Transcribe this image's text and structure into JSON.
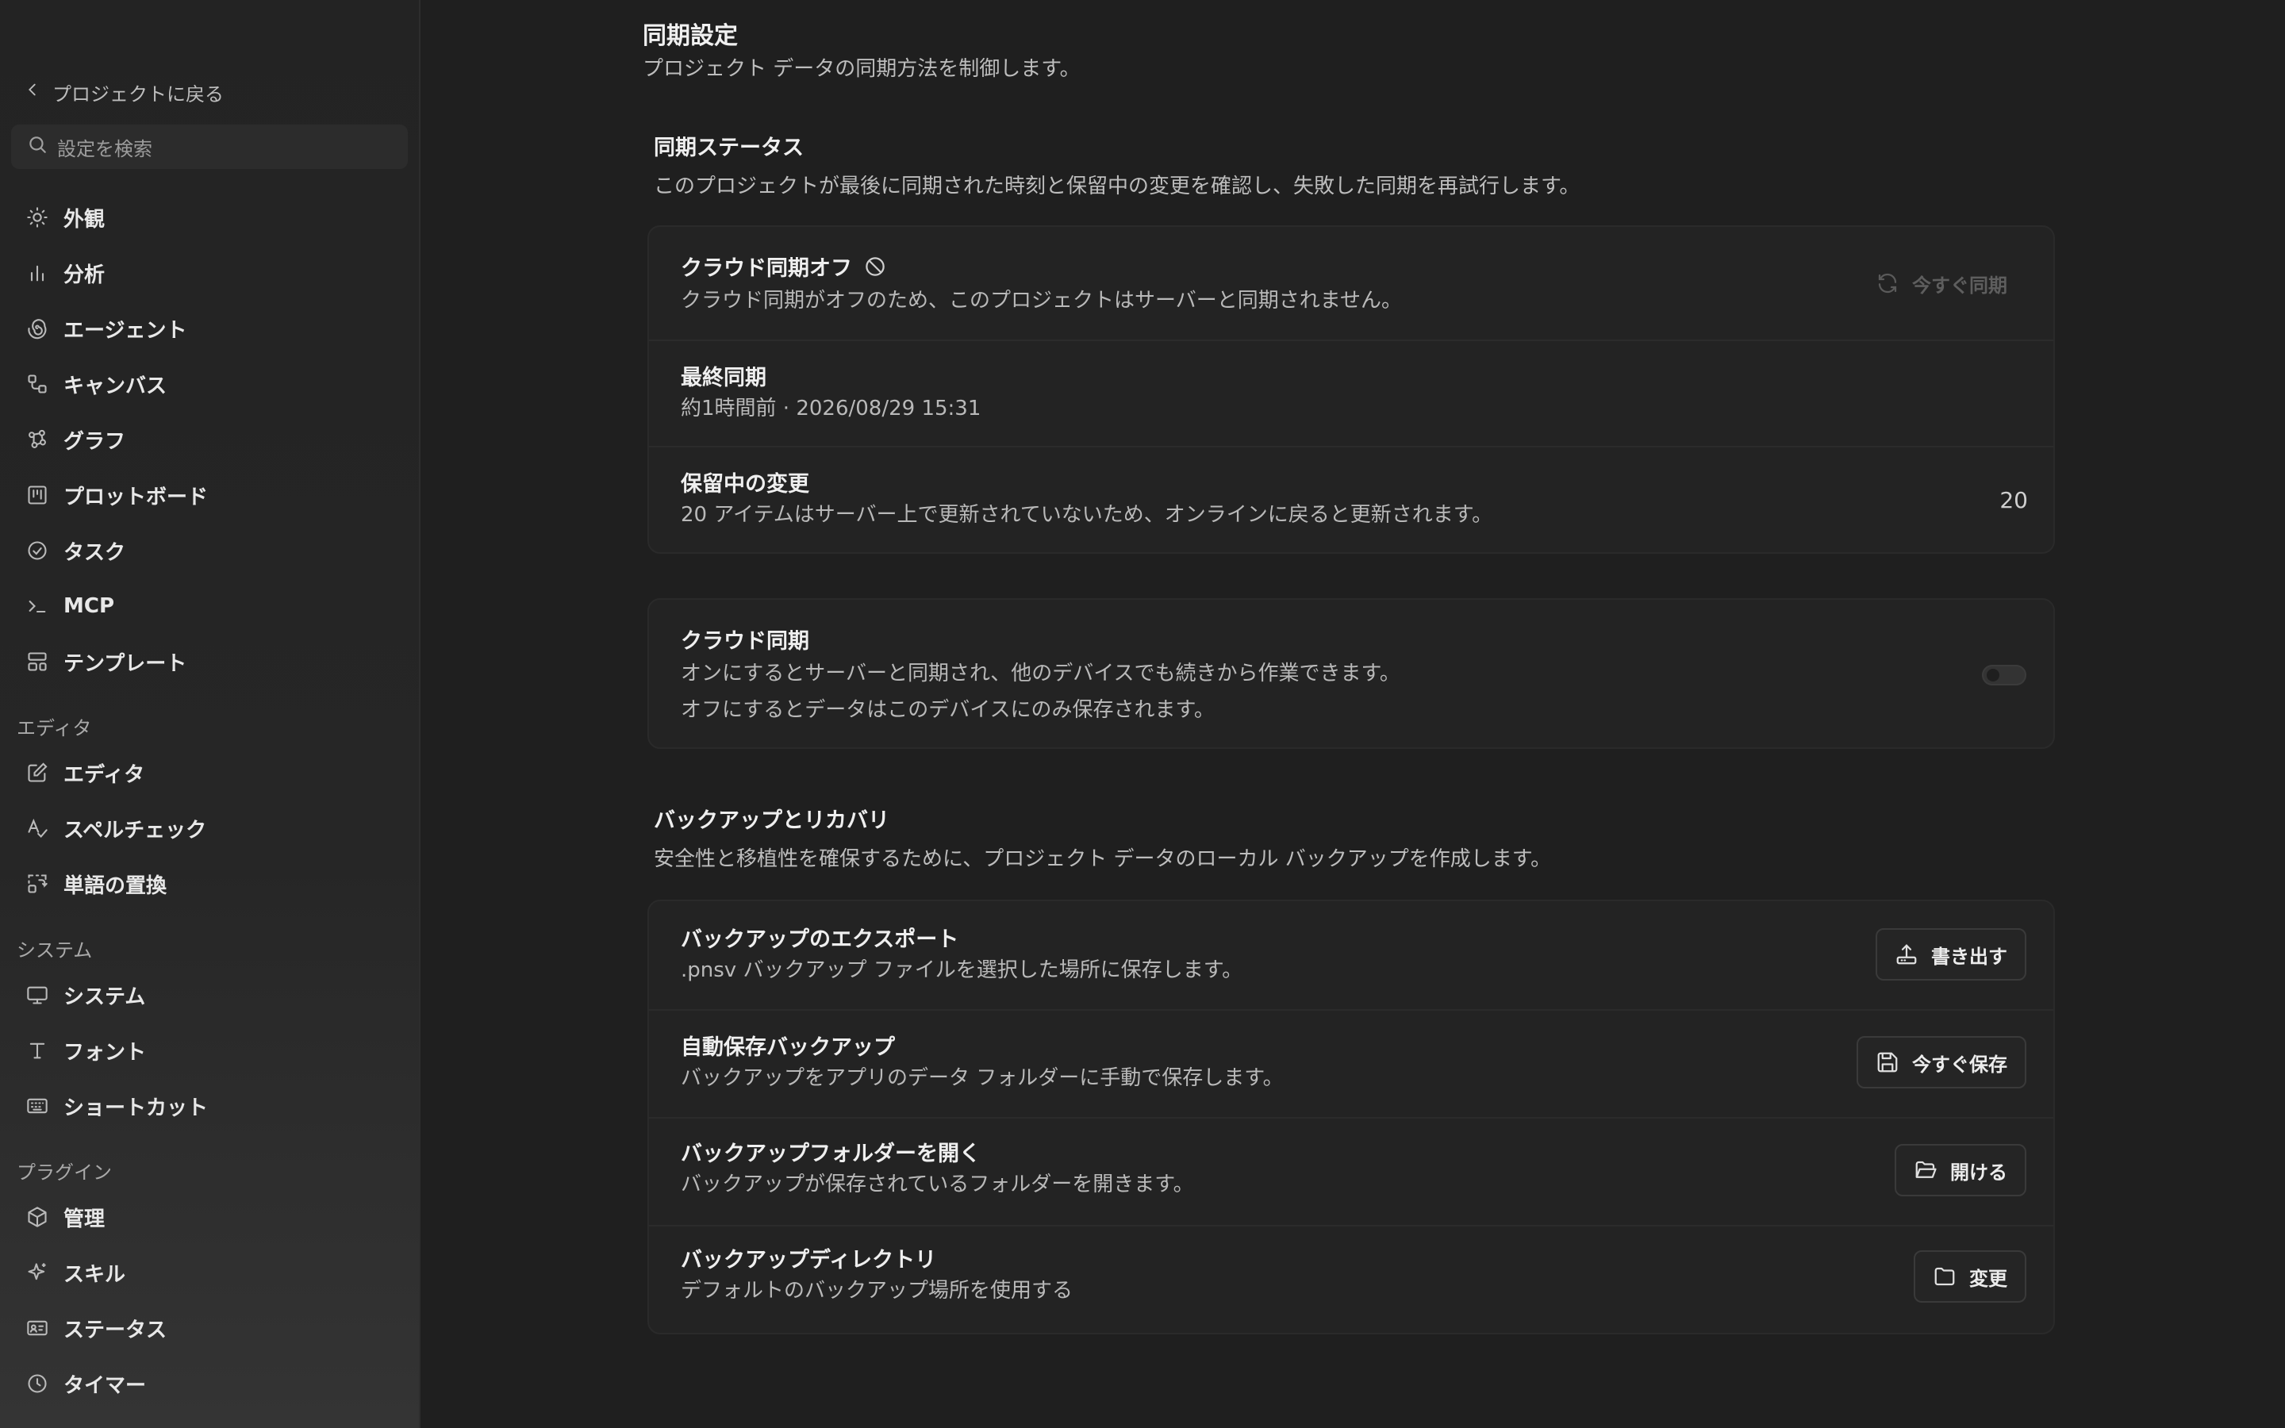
{
  "sidebar": {
    "back_label": "プロジェクトに戻る",
    "search_placeholder": "設定を検索",
    "items": [
      {
        "label": "外観",
        "icon": "sun-icon"
      },
      {
        "label": "分析",
        "icon": "bar-chart-icon"
      },
      {
        "label": "エージェント",
        "icon": "spiral-icon"
      },
      {
        "label": "キャンバス",
        "icon": "canvas-icon"
      },
      {
        "label": "グラフ",
        "icon": "graph-icon"
      },
      {
        "label": "プロットボード",
        "icon": "kanban-icon"
      },
      {
        "label": "タスク",
        "icon": "check-circle-icon"
      },
      {
        "label": "MCP",
        "icon": "terminal-icon"
      },
      {
        "label": "テンプレート",
        "icon": "template-icon"
      }
    ],
    "editor_group": "エディタ",
    "editor_items": [
      {
        "label": "エディタ",
        "icon": "edit-icon"
      },
      {
        "label": "スペルチェック",
        "icon": "spellcheck-icon"
      },
      {
        "label": "単語の置換",
        "icon": "replace-icon"
      }
    ],
    "system_group": "システム",
    "system_items": [
      {
        "label": "システム",
        "icon": "monitor-icon"
      },
      {
        "label": "フォント",
        "icon": "type-icon"
      },
      {
        "label": "ショートカット",
        "icon": "keyboard-icon"
      }
    ],
    "plugin_group": "プラグイン",
    "plugin_items": [
      {
        "label": "管理",
        "icon": "box-icon"
      },
      {
        "label": "スキル",
        "icon": "sparkle-icon"
      },
      {
        "label": "ステータス",
        "icon": "id-card-icon"
      },
      {
        "label": "タイマー",
        "icon": "clock-icon"
      }
    ]
  },
  "main": {
    "title": "同期設定",
    "subtitle": "プロジェクト データの同期方法を制御します。",
    "sync_status": {
      "title": "同期ステータス",
      "description": "このプロジェクトが最後に同期された時刻と保留中の変更を確認し、失敗した同期を再試行します。",
      "cloud_off": {
        "title": "クラウド同期オフ",
        "description": "クラウド同期がオフのため、このプロジェクトはサーバーと同期されません。",
        "button": "今すぐ同期"
      },
      "last_sync": {
        "title": "最終同期",
        "value": "約1時間前 · 2026/08/29 15:31"
      },
      "pending": {
        "title": "保留中の変更",
        "description": "20 アイテムはサーバー上で更新されていないため、オンラインに戻ると更新されます。",
        "count": "20"
      }
    },
    "cloud_sync": {
      "title": "クラウド同期",
      "line1": "オンにするとサーバーと同期され、他のデバイスでも続きから作業できます。",
      "line2": "オフにするとデータはこのデバイスにのみ保存されます。",
      "enabled": false
    },
    "backup": {
      "title": "バックアップとリカバリ",
      "description": "安全性と移植性を確保するために、プロジェクト データのローカル バックアップを作成します。",
      "export": {
        "title": "バックアップのエクスポート",
        "description": ".pnsv バックアップ ファイルを選択した場所に保存します。",
        "button": "書き出す"
      },
      "autosave": {
        "title": "自動保存バックアップ",
        "description": "バックアップをアプリのデータ フォルダーに手動で保存します。",
        "button": "今すぐ保存"
      },
      "open_folder": {
        "title": "バックアップフォルダーを開く",
        "description": "バックアップが保存されているフォルダーを開きます。",
        "button": "開ける"
      },
      "directory": {
        "title": "バックアップディレクトリ",
        "description": "デフォルトのバックアップ場所を使用する",
        "button": "変更"
      }
    }
  },
  "colors": {
    "background": "#1f1f1f",
    "sidebar": "#242424",
    "card": "#232323",
    "text": "#ececec",
    "muted": "#b9b9b9"
  }
}
